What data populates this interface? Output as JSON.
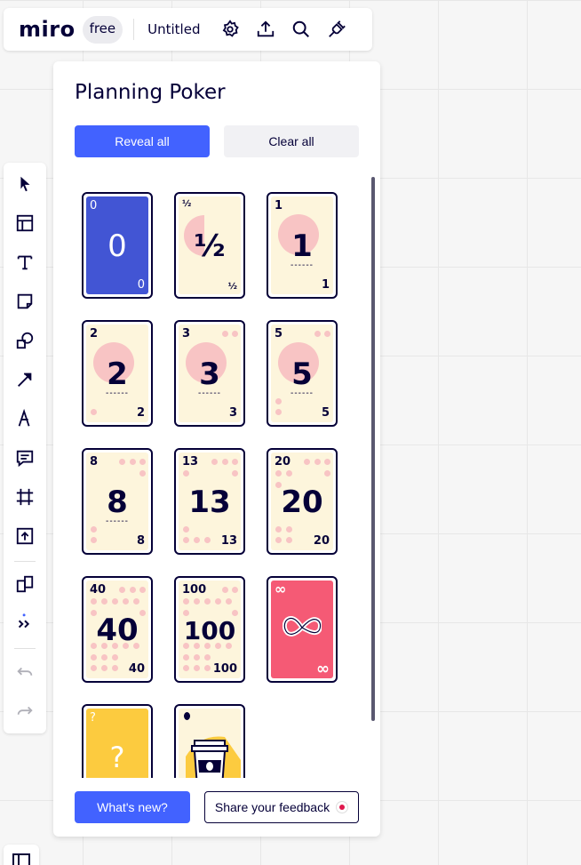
{
  "topbar": {
    "logo": "miro",
    "plan_badge": "free",
    "board_title": "Untitled",
    "icons": [
      "settings-icon",
      "upload-icon",
      "search-icon",
      "plugin-icon"
    ]
  },
  "left_toolbar": {
    "tools": [
      "select-cursor-icon",
      "templates-icon",
      "text-icon",
      "sticky-note-icon",
      "shapes-icon",
      "arrow-line-icon",
      "pen-icon",
      "comment-icon",
      "frame-icon",
      "upload-icon",
      "apps-icon",
      "more-tools-icon",
      "undo-icon",
      "redo-icon"
    ]
  },
  "panel": {
    "title": "Planning Poker",
    "reveal_all": "Reveal all",
    "clear_all": "Clear all",
    "whats_new": "What's new?",
    "feedback": "Share your feedback",
    "cards": [
      {
        "value": "0",
        "style": "blue"
      },
      {
        "value": "½",
        "style": "cream"
      },
      {
        "value": "1",
        "style": "cream"
      },
      {
        "value": "2",
        "style": "cream"
      },
      {
        "value": "3",
        "style": "cream"
      },
      {
        "value": "5",
        "style": "cream"
      },
      {
        "value": "8",
        "style": "cream"
      },
      {
        "value": "13",
        "style": "cream"
      },
      {
        "value": "20",
        "style": "cream"
      },
      {
        "value": "40",
        "style": "cream"
      },
      {
        "value": "100",
        "style": "cream"
      },
      {
        "value": "∞",
        "style": "red"
      },
      {
        "value": "?",
        "style": "yellow"
      },
      {
        "value": "",
        "style": "coffee"
      }
    ]
  },
  "colors": {
    "accent": "#4262ff",
    "ink": "#050038",
    "card_cream": "#fdf5dc",
    "card_blue": "#4255d4",
    "card_red": "#f55a75",
    "card_yellow": "#fccb3f",
    "pip_pink": "#f8c4c4"
  }
}
